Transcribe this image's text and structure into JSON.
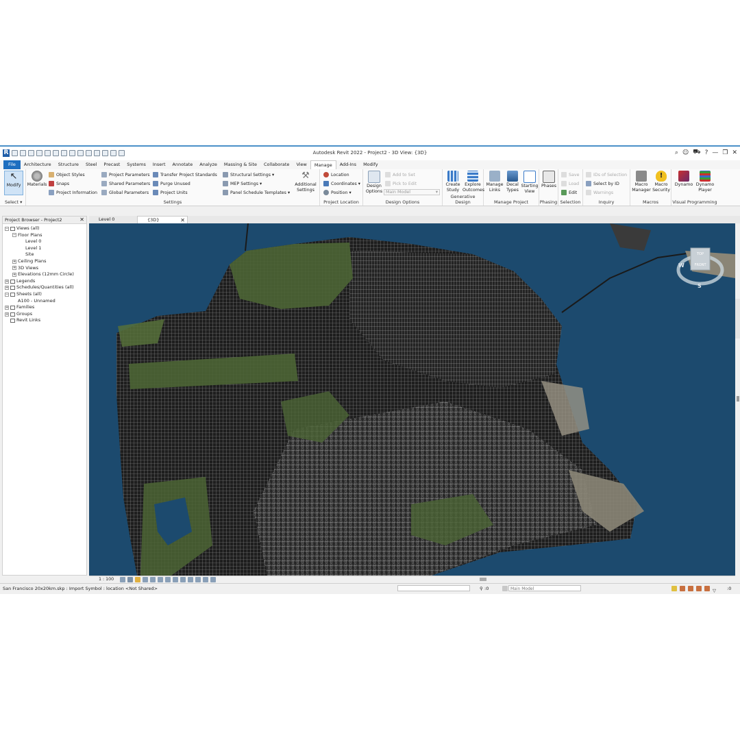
{
  "app": {
    "title": "Autodesk Revit 2022 - Project2 - 3D View: {3D}"
  },
  "tabs": [
    "File",
    "Architecture",
    "Structure",
    "Steel",
    "Precast",
    "Systems",
    "Insert",
    "Annotate",
    "Analyze",
    "Massing & Site",
    "Collaborate",
    "View",
    "Manage",
    "Add-Ins",
    "Modify"
  ],
  "active_tab": "Manage",
  "ribbon": {
    "select": {
      "modify": "Modify",
      "label": "Select ▾"
    },
    "settings": {
      "label": "Settings",
      "materials": "Materials",
      "object_styles": "Object  Styles",
      "snaps": "Snaps",
      "project_information": "Project  Information",
      "project_parameters": "Project  Parameters",
      "shared_parameters": "Shared  Parameters",
      "global_parameters": "Global  Parameters",
      "transfer_project_standards": "Transfer  Project Standards",
      "purge_unused": "Purge  Unused",
      "project_units": "Project  Units",
      "structural_settings": "Structural  Settings  ▾",
      "mep_settings": "MEP  Settings  ▾",
      "panel_schedule_templates": "Panel Schedule  Templates  ▾",
      "additional_settings_1": "Additional",
      "additional_settings_2": "Settings"
    },
    "project_location": {
      "label": "Project Location",
      "location": "Location",
      "coordinates": "Coordinates  ▾",
      "position": "Position  ▾"
    },
    "design_options": {
      "label": "Design Options",
      "design_options_1": "Design",
      "design_options_2": "Options",
      "add_to_set": "Add to Set",
      "pick_to_edit": "Pick to Edit",
      "main_model": "Main Model"
    },
    "generative_design": {
      "label": "Generative Design",
      "create_1": "Create",
      "create_2": "Study",
      "explore_1": "Explore",
      "explore_2": "Outcomes"
    },
    "manage_project": {
      "label": "Manage Project",
      "manage_links_1": "Manage",
      "manage_links_2": "Links",
      "decal_1": "Decal",
      "decal_2": "Types",
      "starting_1": "Starting",
      "starting_2": "View"
    },
    "phasing": {
      "label": "Phasing",
      "phases": "Phases"
    },
    "selection": {
      "label": "Selection",
      "save": "Save",
      "load": "Load",
      "edit": "Edit"
    },
    "inquiry": {
      "label": "Inquiry",
      "ids": "IDs of  Selection",
      "select_by_id": "Select  by ID",
      "warnings": "Warnings"
    },
    "macros": {
      "label": "Macros",
      "manager_1": "Macro",
      "manager_2": "Manager",
      "security_1": "Macro",
      "security_2": "Security"
    },
    "visual_programming": {
      "label": "Visual Programming",
      "dynamo": "Dynamo",
      "player_1": "Dynamo",
      "player_2": "Player"
    }
  },
  "project_browser": {
    "title": "Project Browser - Project2",
    "items": [
      {
        "label": "Views (all)",
        "level": 0,
        "toggle": "−"
      },
      {
        "label": "Floor Plans",
        "level": 1,
        "toggle": "−"
      },
      {
        "label": "Level 0",
        "level": 2,
        "toggle": ""
      },
      {
        "label": "Level 1",
        "level": 2,
        "toggle": ""
      },
      {
        "label": "Site",
        "level": 2,
        "toggle": ""
      },
      {
        "label": "Ceiling Plans",
        "level": 1,
        "toggle": "+"
      },
      {
        "label": "3D Views",
        "level": 1,
        "toggle": "+"
      },
      {
        "label": "Elevations (12mm Circle)",
        "level": 1,
        "toggle": "+"
      },
      {
        "label": "Legends",
        "level": 0,
        "toggle": "+"
      },
      {
        "label": "Schedules/Quantities (all)",
        "level": 0,
        "toggle": "+"
      },
      {
        "label": "Sheets (all)",
        "level": 0,
        "toggle": "−"
      },
      {
        "label": "A100 - Unnamed",
        "level": 1,
        "toggle": ""
      },
      {
        "label": "Families",
        "level": 0,
        "toggle": "+"
      },
      {
        "label": "Groups",
        "level": 0,
        "toggle": "+"
      },
      {
        "label": "Revit Links",
        "level": 0,
        "toggle": ""
      }
    ]
  },
  "view_tabs": [
    {
      "label": "Level 0",
      "active": false
    },
    {
      "label": "{3D}",
      "active": true
    }
  ],
  "view_cube": {
    "top": "TOP",
    "front": "FRONT",
    "west": "W",
    "south": "S"
  },
  "view_bar": {
    "scale": "1 : 100"
  },
  "status_bar": {
    "message": "San Francisco 20x20km.skp : Import Symbol : location <Not Shared>",
    "zero": ":0",
    "model": "Main Model",
    "filter": ":0"
  },
  "colors": {
    "accent": "#1f6fc0",
    "water": "#1c4a6e",
    "land_green": "#4b6434",
    "city": "#2a2a2a"
  }
}
